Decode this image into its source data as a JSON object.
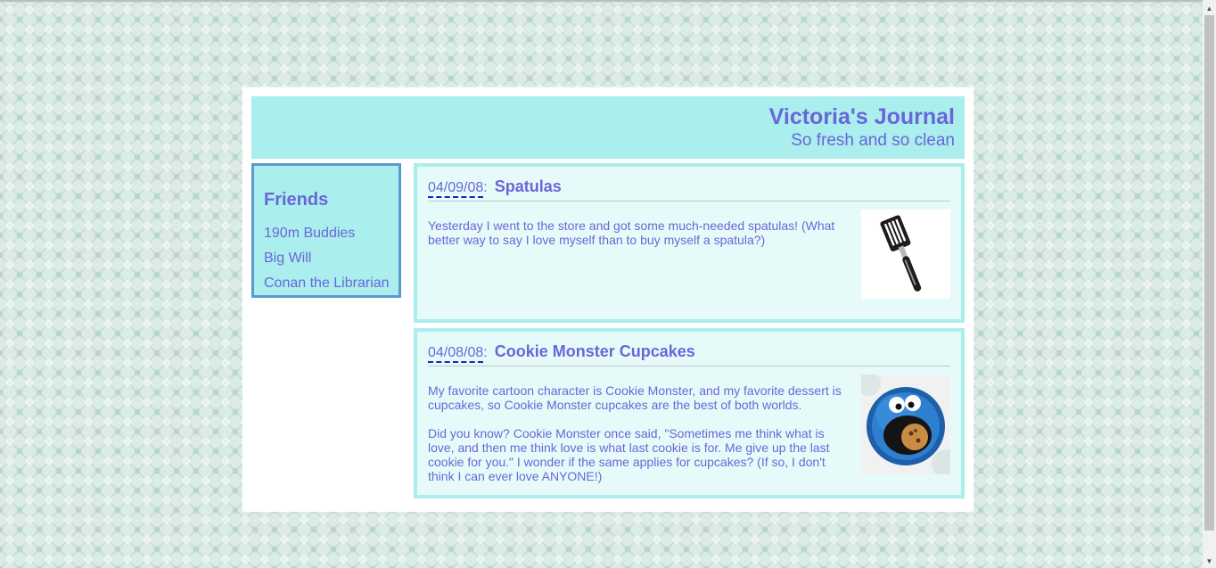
{
  "header": {
    "title": "Victoria's Journal",
    "subtitle": "So fresh and so clean"
  },
  "sidebar": {
    "heading": "Friends",
    "friends": [
      "190m Buddies",
      "Big Will",
      "Conan the Librarian"
    ]
  },
  "posts": [
    {
      "date": "04/09/08",
      "title": "Spatulas",
      "paragraphs": [
        "Yesterday I went to the store and got some much-needed spatulas! (What better way to say I love myself than to buy myself a spatula?)"
      ],
      "image": "spatula-photo"
    },
    {
      "date": "04/08/08",
      "title": "Cookie Monster Cupcakes",
      "paragraphs": [
        "My favorite cartoon character is Cookie Monster, and my favorite dessert is cupcakes, so Cookie Monster cupcakes are the best of both worlds.",
        "Did you know? Cookie Monster once said, \"Sometimes me think what is love, and then me think love is what last cookie is for. Me give up the last cookie for you.\" I wonder if the same applies for cupcakes? (If so, I don't think I can ever love ANYONE!)"
      ],
      "image": "cookie-monster-cupcake-photo"
    }
  ],
  "colors": {
    "accent_text": "#6a66d8",
    "header_bg": "#aaeeed",
    "sidebar_border": "#5b9ad0",
    "post_bg": "#e6fbf9",
    "date_underline": "#1b20c8"
  }
}
